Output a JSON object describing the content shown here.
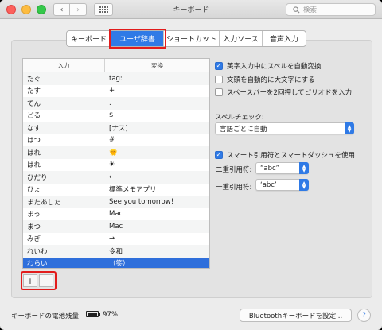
{
  "window": {
    "title": "キーボード"
  },
  "toolbar": {
    "back_icon": "chevron-left-icon",
    "forward_icon": "chevron-right-icon",
    "grid_icon": "show-all-grid-icon"
  },
  "search": {
    "placeholder": "検索"
  },
  "tabs": [
    {
      "label": "キーボード",
      "selected": false
    },
    {
      "label": "ユーザ辞書",
      "selected": true
    },
    {
      "label": "ショートカット",
      "selected": false
    },
    {
      "label": "入力ソース",
      "selected": false
    },
    {
      "label": "音声入力",
      "selected": false
    }
  ],
  "table": {
    "headers": [
      "入力",
      "変換"
    ],
    "rows": [
      {
        "input": "たぐ",
        "output": "tag:"
      },
      {
        "input": "たす",
        "output": "+"
      },
      {
        "input": "てん",
        "output": "."
      },
      {
        "input": "どる",
        "output": "$"
      },
      {
        "input": "なす",
        "output": "[ナス]"
      },
      {
        "input": "はつ",
        "output": "#"
      },
      {
        "input": "はれ",
        "output": "🌞"
      },
      {
        "input": "はれ",
        "output": "☀"
      },
      {
        "input": "ひだり",
        "output": "←"
      },
      {
        "input": "ひょ",
        "output": "標準メモアプリ"
      },
      {
        "input": "またあした",
        "output": "See you tomorrow!"
      },
      {
        "input": "まっ",
        "output": "Mac"
      },
      {
        "input": "まつ",
        "output": "Mac"
      },
      {
        "input": "みぎ",
        "output": "→"
      },
      {
        "input": "れいわ",
        "output": "令和"
      },
      {
        "input": "わらい",
        "output": "（笑）",
        "selected": true
      }
    ]
  },
  "buttons": {
    "add": "+",
    "remove": "−",
    "bluetooth": "Bluetoothキーボードを設定...",
    "help": "?"
  },
  "options": {
    "auto_correct": {
      "label": "英字入力中にスペルを自動変換",
      "checked": true
    },
    "auto_capitalize": {
      "label": "文頭を自動的に大文字にする",
      "checked": false
    },
    "double_space_period": {
      "label": "スペースバーを2回押してピリオドを入力",
      "checked": false
    },
    "spelling_label": "スペルチェック:",
    "spelling_value": "言語ごとに自動",
    "smart_quotes": {
      "label": "スマート引用符とスマートダッシュを使用",
      "checked": true
    },
    "double_quote_label": "二重引用符:",
    "double_quote_value": "“abc”",
    "single_quote_label": "一重引用符:",
    "single_quote_value": "‘abc’"
  },
  "footer": {
    "battery_label": "キーボードの電池残量:",
    "battery_percent": "97%",
    "battery_level": 0.97
  },
  "colors": {
    "accent": "#2f7ae6",
    "highlight": "#e21c1c",
    "selection": "#2f6fdb"
  }
}
